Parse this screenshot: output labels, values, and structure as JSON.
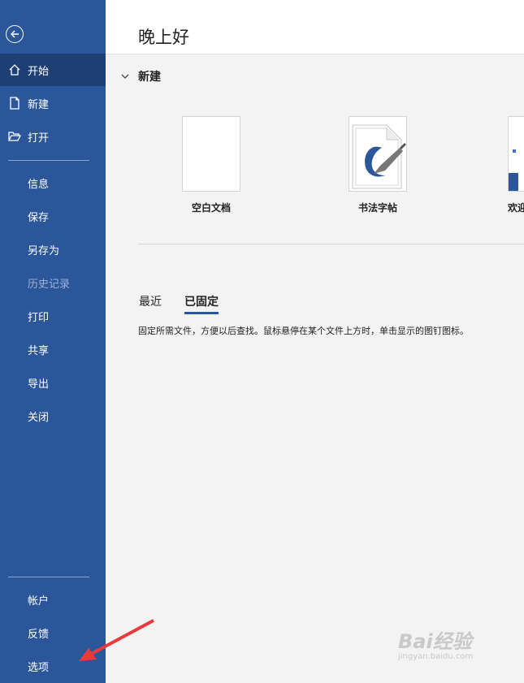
{
  "sidebar": {
    "back_icon": "back-arrow-circle-icon",
    "items_top": [
      {
        "label": "开始",
        "icon": "home-icon",
        "active": true
      },
      {
        "label": "新建",
        "icon": "new-document-icon"
      },
      {
        "label": "打开",
        "icon": "open-folder-icon"
      }
    ],
    "items_mid": [
      {
        "label": "信息"
      },
      {
        "label": "保存"
      },
      {
        "label": "另存为"
      },
      {
        "label": "历史记录",
        "disabled": true
      },
      {
        "label": "打印"
      },
      {
        "label": "共享"
      },
      {
        "label": "导出"
      },
      {
        "label": "关闭"
      }
    ],
    "items_bottom": [
      {
        "label": "帐户"
      },
      {
        "label": "反馈"
      },
      {
        "label": "选项"
      }
    ]
  },
  "main": {
    "greeting": "晚上好",
    "new_section": {
      "title": "新建",
      "icon": "chevron-down-icon"
    },
    "templates": [
      {
        "name": "空白文档"
      },
      {
        "name": "书法字帖"
      },
      {
        "name": "欢迎"
      }
    ],
    "tabs": [
      {
        "label": "最近"
      },
      {
        "label": "已固定",
        "active": true
      }
    ],
    "pinned_hint": "固定所需文件，方便以后查找。鼠标悬停在某个文件上方时，单击显示的图钉图标。"
  },
  "watermark": {
    "main": "Bai经验",
    "sub": "jingyan.baidu.com"
  },
  "colors": {
    "sidebar": "#2b579a",
    "sidebar_active": "#1e3f73",
    "arrow": "#e8393b"
  }
}
